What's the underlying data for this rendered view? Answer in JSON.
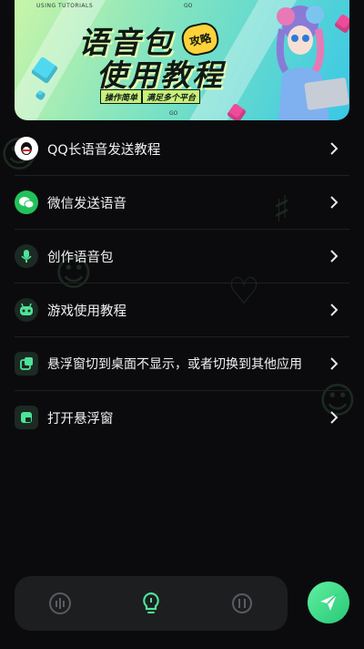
{
  "banner": {
    "top_caption": "USING TUTORIALS",
    "top_caption_right": "GO",
    "title_line1": "语音包",
    "title_line2": "使用教程",
    "badge": "攻略",
    "sub_left": "操作简单",
    "sub_right": "满足多个平台",
    "bottom_caption": "GO"
  },
  "menu": {
    "items": [
      {
        "label": "QQ长语音发送教程",
        "icon": "qq-icon"
      },
      {
        "label": "微信发送语音",
        "icon": "wechat-icon"
      },
      {
        "label": "创作语音包",
        "icon": "microphone-icon"
      },
      {
        "label": "游戏使用教程",
        "icon": "gamepad-icon"
      },
      {
        "label": "悬浮窗切到桌面不显示，或者切换到其他应用",
        "icon": "floating-window-icon"
      },
      {
        "label": "打开悬浮窗",
        "icon": "open-window-icon"
      }
    ]
  },
  "bottom_nav": {
    "tabs": [
      {
        "icon": "waveform-icon",
        "active": false
      },
      {
        "icon": "lightbulb-icon",
        "active": true
      },
      {
        "icon": "mascot-icon",
        "active": false
      }
    ],
    "send_icon": "send-icon"
  },
  "colors": {
    "accent": "#4fe39a",
    "background": "#0b0b0d",
    "bar": "#1d1e20"
  }
}
